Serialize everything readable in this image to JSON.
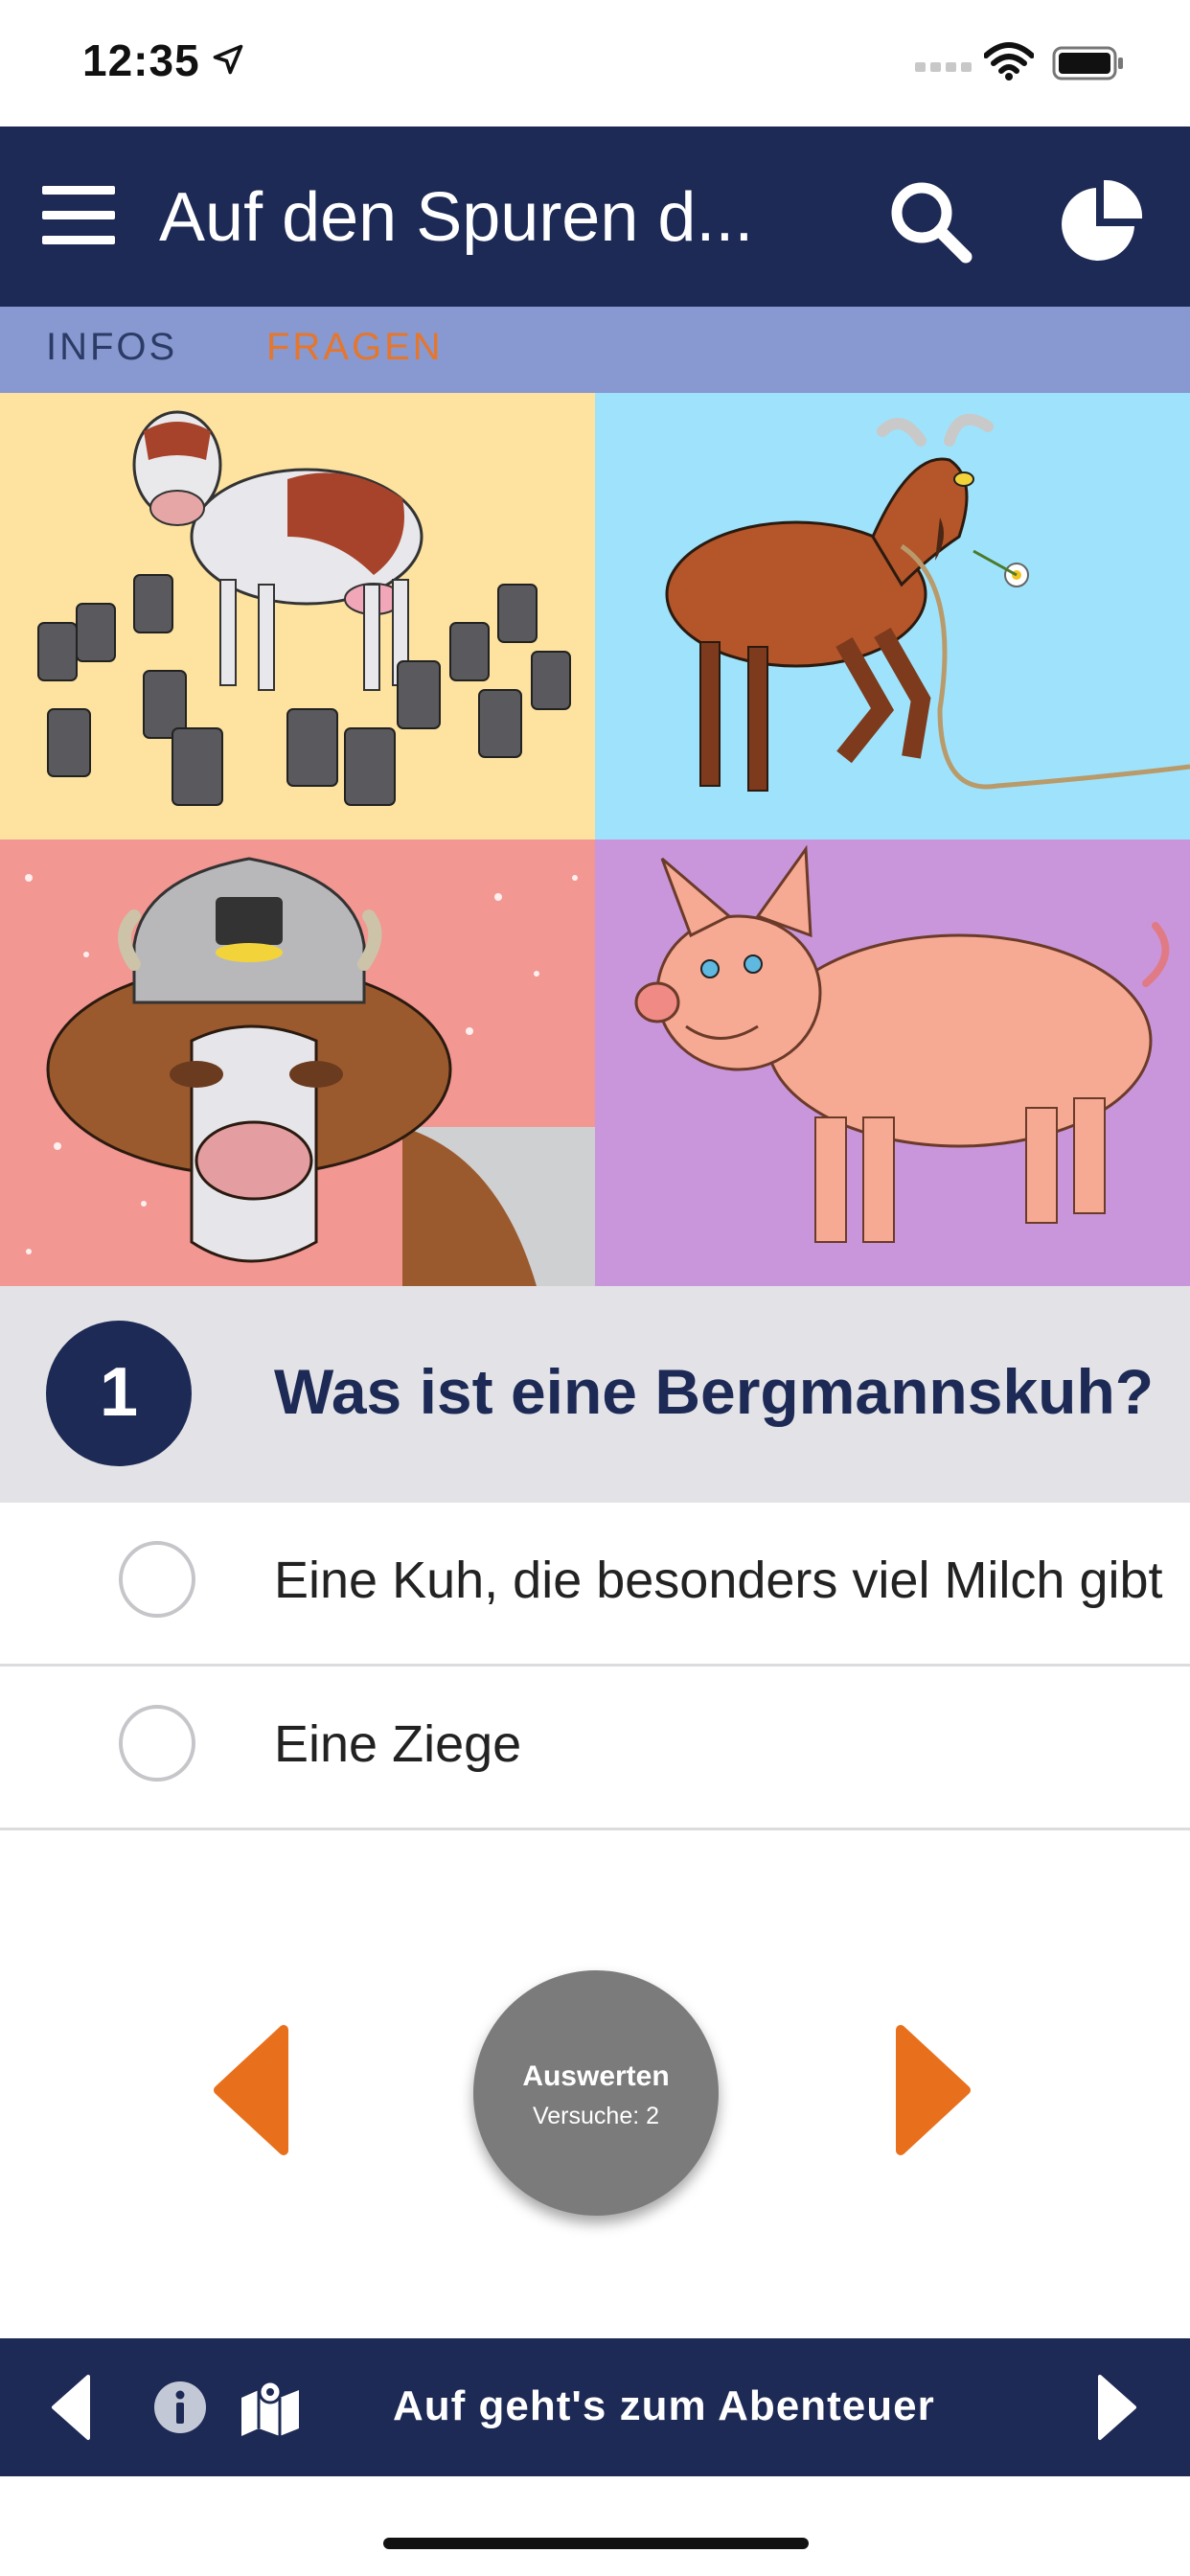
{
  "status_bar": {
    "time": "12:35",
    "icons": [
      "location-arrow-icon",
      "signal-icon",
      "wifi-icon",
      "battery-icon"
    ]
  },
  "header": {
    "title": "Auf den Spuren d...",
    "icons": [
      "menu-icon",
      "search-icon",
      "stats-pie-icon"
    ],
    "background": "#1d2a55"
  },
  "tabs": [
    {
      "label": "INFOS",
      "active": false
    },
    {
      "label": "FRAGEN",
      "active": true
    }
  ],
  "colors": {
    "navy": "#1d2a55",
    "tab_bar": "#8799d0",
    "accent_orange": "#e6762c",
    "tile_colors": [
      "#fde39f",
      "#9ee3fb",
      "#f29791",
      "#c996dc"
    ]
  },
  "image_tiles": [
    {
      "subject": "cow-with-milk-cans-image"
    },
    {
      "subject": "goat-with-rope-image"
    },
    {
      "subject": "cow-with-miner-helmet-image"
    },
    {
      "subject": "pig-image"
    }
  ],
  "question": {
    "number": "1",
    "text": "Was ist eine Bergmannskuh?"
  },
  "answers": [
    {
      "label": "Eine Kuh, die besonders viel Milch gibt",
      "selected": false
    },
    {
      "label": "Eine Ziege",
      "selected": false
    }
  ],
  "controls": {
    "evaluate_label": "Auswerten",
    "attempts_label": "Versuche: 2"
  },
  "bottom_bar": {
    "label": "Auf geht's zum Abenteuer",
    "icons": [
      "back-arrow-icon",
      "info-icon",
      "map-icon",
      "forward-arrow-icon"
    ]
  }
}
